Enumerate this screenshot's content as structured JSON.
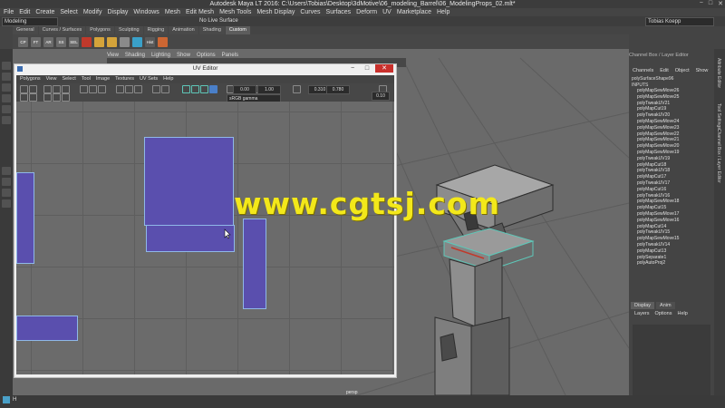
{
  "window": {
    "title": "Autodesk Maya LT 2016: C:\\Users\\Tobias\\Desktop\\3dMotive\\06_modeling_Barrel\\06_ModelingProps_02.mlt*",
    "controls": [
      "−",
      "□",
      "✕"
    ]
  },
  "menubar": [
    "File",
    "Edit",
    "Create",
    "Select",
    "Modify",
    "Display",
    "Windows",
    "Mesh",
    "Edit Mesh",
    "Mesh Tools",
    "Mesh Display",
    "Curves",
    "Surfaces",
    "Deform",
    "UV",
    "Marketplace",
    "Help"
  ],
  "status": {
    "mode": "Modeling",
    "live_surface": "No Live Surface",
    "user": "Tobias Koepp"
  },
  "shelf_tabs": [
    "General",
    "Curves / Surfaces",
    "Polygons",
    "Sculpting",
    "Rigging",
    "Animation",
    "Shading",
    "Custom"
  ],
  "shelf_icons": [
    {
      "label": "CP",
      "color": "#6a6a6a"
    },
    {
      "label": "FT",
      "color": "#6a6a6a"
    },
    {
      "label": "AR",
      "color": "#6a6a6a"
    },
    {
      "label": "SS",
      "color": "#6a6a6a"
    },
    {
      "label": "SEL",
      "color": "#6a6a6a"
    },
    {
      "label": "",
      "color": "#c0392b"
    },
    {
      "label": "",
      "color": "#d4a33a"
    },
    {
      "label": "",
      "color": "#d4a33a"
    },
    {
      "label": "",
      "color": "#8a8a8a"
    },
    {
      "label": "",
      "color": "#3aa0c8"
    },
    {
      "label": "Hist",
      "color": "#5a5a5a"
    },
    {
      "label": "",
      "color": "#cc6633"
    }
  ],
  "viewport": {
    "menu": [
      "View",
      "Shading",
      "Lighting",
      "Show",
      "Options",
      "Panels"
    ],
    "camera": "persp"
  },
  "uv_editor": {
    "title": "UV Editor",
    "menu": [
      "Polygons",
      "View",
      "Select",
      "Tool",
      "Image",
      "Textures",
      "UV Sets",
      "Help"
    ],
    "values": [
      "0.00",
      "1.00",
      "0.310",
      "0.780",
      "0.10"
    ],
    "color_space": "sRGB gamma",
    "shell_color": "#5a4fae",
    "border_color": "#8fb8e8"
  },
  "watermark": "www.cgtsj.com",
  "channel_box": {
    "title": "Channel Box / Layer Editor",
    "menu": [
      "Channels",
      "Edit",
      "Object",
      "Show"
    ],
    "object": "polySurfaceShape96",
    "inputs_label": "INPUTS",
    "history": [
      "polyMapSewMove26",
      "polyMapSewMove25",
      "polyTweakUV21",
      "polyMapCut19",
      "polyTweakUV20",
      "polyMapSewMove24",
      "polyMapSewMove23",
      "polyMapSewMove22",
      "polyMapSewMove21",
      "polyMapSewMove20",
      "polyMapSewMove19",
      "polyTweakUV19",
      "polyMapCut18",
      "polyTweakUV18",
      "polyMapCut17",
      "polyTweakUV17",
      "polyMapCut16",
      "polyTweakUV16",
      "polyMapSewMove18",
      "polyMapCut15",
      "polyMapSewMove17",
      "polyMapSewMove16",
      "polyMapCut14",
      "polyTweakUV15",
      "polyMapSewMove15",
      "polyTweakUV14",
      "polyMapCut13",
      "polySeparate1",
      "polyAutoProj2"
    ]
  },
  "layer_editor": {
    "tabs": [
      "Display",
      "Anim"
    ],
    "menu": [
      "Layers",
      "Options",
      "Help"
    ]
  },
  "side_tabs": [
    "Attribute Editor",
    "Tool Settings",
    "Channel Box / Layer Editor"
  ],
  "taskbar_label": "H"
}
